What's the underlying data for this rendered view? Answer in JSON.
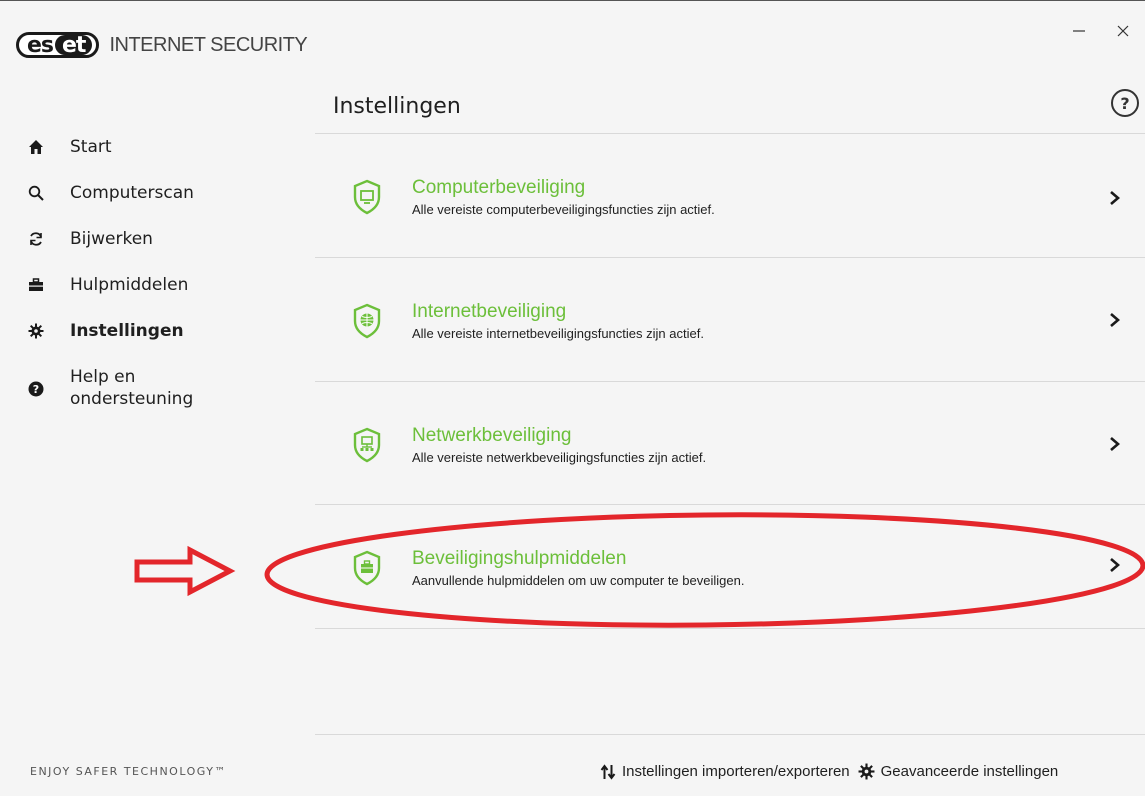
{
  "app": {
    "logo_text_1": "es",
    "logo_text_2": "et",
    "product_name": "INTERNET SECURITY",
    "tagline": "ENJOY SAFER TECHNOLOGY™"
  },
  "window_controls": {
    "minimize": "—",
    "close": "✕"
  },
  "sidebar": {
    "items": [
      {
        "label": "Start",
        "icon": "home-icon",
        "active": false
      },
      {
        "label": "Computerscan",
        "icon": "search-icon",
        "active": false
      },
      {
        "label": "Bijwerken",
        "icon": "refresh-icon",
        "active": false
      },
      {
        "label": "Hulpmiddelen",
        "icon": "toolbox-icon",
        "active": false
      },
      {
        "label": "Instellingen",
        "icon": "gear-icon",
        "active": true
      },
      {
        "label": "Help en ondersteuning",
        "icon": "help-circle-icon",
        "active": false
      }
    ]
  },
  "main": {
    "title": "Instellingen",
    "help_symbol": "?",
    "sections": [
      {
        "title": "Computerbeveiliging",
        "description": "Alle vereiste computerbeveiligingsfuncties zijn actief.",
        "icon": "shield-monitor-icon"
      },
      {
        "title": "Internetbeveiliging",
        "description": "Alle vereiste internetbeveiligingsfuncties zijn actief.",
        "icon": "shield-globe-icon"
      },
      {
        "title": "Netwerkbeveiliging",
        "description": "Alle vereiste netwerkbeveiligingsfuncties zijn actief.",
        "icon": "shield-network-icon"
      },
      {
        "title": "Beveiligingshulpmiddelen",
        "description": "Aanvullende hulpmiddelen om uw computer te beveiligen.",
        "icon": "shield-toolbox-icon"
      }
    ]
  },
  "footer": {
    "import_export_label": "Instellingen importeren/exporteren",
    "advanced_label": "Geavanceerde instellingen"
  },
  "colors": {
    "accent_green": "#6cbf3a",
    "annotation_red": "#e3262b"
  }
}
